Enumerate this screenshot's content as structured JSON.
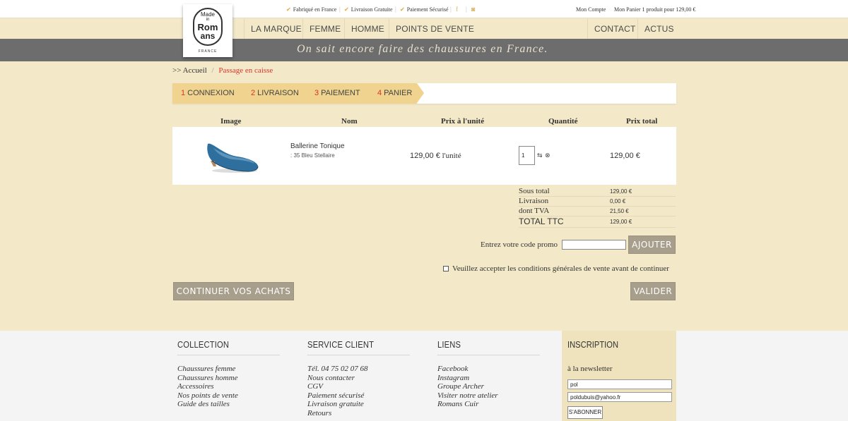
{
  "topbar": {
    "features": [
      "Fabriqué en France",
      "Livraison Gratuite",
      "Paiement Sécurisé"
    ],
    "social_icons": [
      "facebook-icon",
      "instagram-icon"
    ],
    "account": "Mon Compte",
    "cart_summary": "Mon Panier 1 produit pour 129,00 €"
  },
  "logo": {
    "line1": "Made",
    "line2": "in",
    "line3": "Rom",
    "line4": "ans",
    "country": "FRANCE"
  },
  "nav": {
    "left": [
      "LA MARQUE",
      "FEMME",
      "HOMME",
      "POINTS DE VENTE"
    ],
    "right": [
      "CONTACT",
      "ACTUS"
    ]
  },
  "slogan": "On sait encore faire des chaussures en France.",
  "breadcrumb": {
    "prefix": ">>",
    "home": "Accueil",
    "separator": "/",
    "current": "Passage en caisse"
  },
  "steps": [
    {
      "num": "1",
      "label": "CONNEXION"
    },
    {
      "num": "2",
      "label": "LIVRAISON"
    },
    {
      "num": "3",
      "label": "PAIEMENT"
    },
    {
      "num": "4",
      "label": "PANIER"
    }
  ],
  "cart": {
    "headers": [
      "Image",
      "Nom",
      "Prix à l'unité",
      "Quantité",
      "Prix total"
    ],
    "item": {
      "name": "Ballerine Tonique",
      "variant": ": 35 Bleu Stellaire",
      "unit_price": "129,00 €",
      "unit_suffix": "l'unité",
      "quantity": "1",
      "total": "129,00 €"
    }
  },
  "totals": [
    {
      "label": "Sous total",
      "value": "129,00 €"
    },
    {
      "label": "Livraison",
      "value": "0,00 €"
    },
    {
      "label": "dont TVA",
      "value": "21,50 €"
    },
    {
      "label": "TOTAL TTC",
      "value": "129,00 €"
    }
  ],
  "promo": {
    "label": "Entrez votre code promo",
    "value": "",
    "button": "AJOUTER"
  },
  "cgv_label": "Veuillez accepter les conditions générales de vente avant de continuer",
  "buttons": {
    "continue": "CONTINUER VOS ACHATS",
    "validate": "VALIDER"
  },
  "footer": {
    "collection": {
      "title": "COLLECTION",
      "items": [
        "Chaussures femme",
        "Chaussures homme",
        "Accessoires",
        "Nos points de vente",
        "Guide des tailles"
      ]
    },
    "service": {
      "title": "SERVICE CLIENT",
      "items": [
        "Tél. 04 75 02 07 68",
        "Nous contacter",
        "CGV",
        "Paiement sécurisé",
        "Livraison gratuite",
        "Retours"
      ]
    },
    "links": {
      "title": "LIENS",
      "items": [
        "Facebook",
        "Instagram",
        "Groupe Archer",
        "Visiter notre atelier",
        "Romans Cuir"
      ]
    },
    "newsletter": {
      "title": "INSCRIPTION",
      "subtitle": "à la newsletter",
      "name_value": "pol",
      "email_value": "poldubuis@yahoo.fr",
      "button": "S'ABONNER"
    }
  },
  "colors": {
    "page_bg": "#f3e9c9",
    "accent_red": "#d9342b",
    "step_fill": "#efd38f",
    "band_grey": "#6d6d6d",
    "button_grey": "#a89e8c"
  }
}
